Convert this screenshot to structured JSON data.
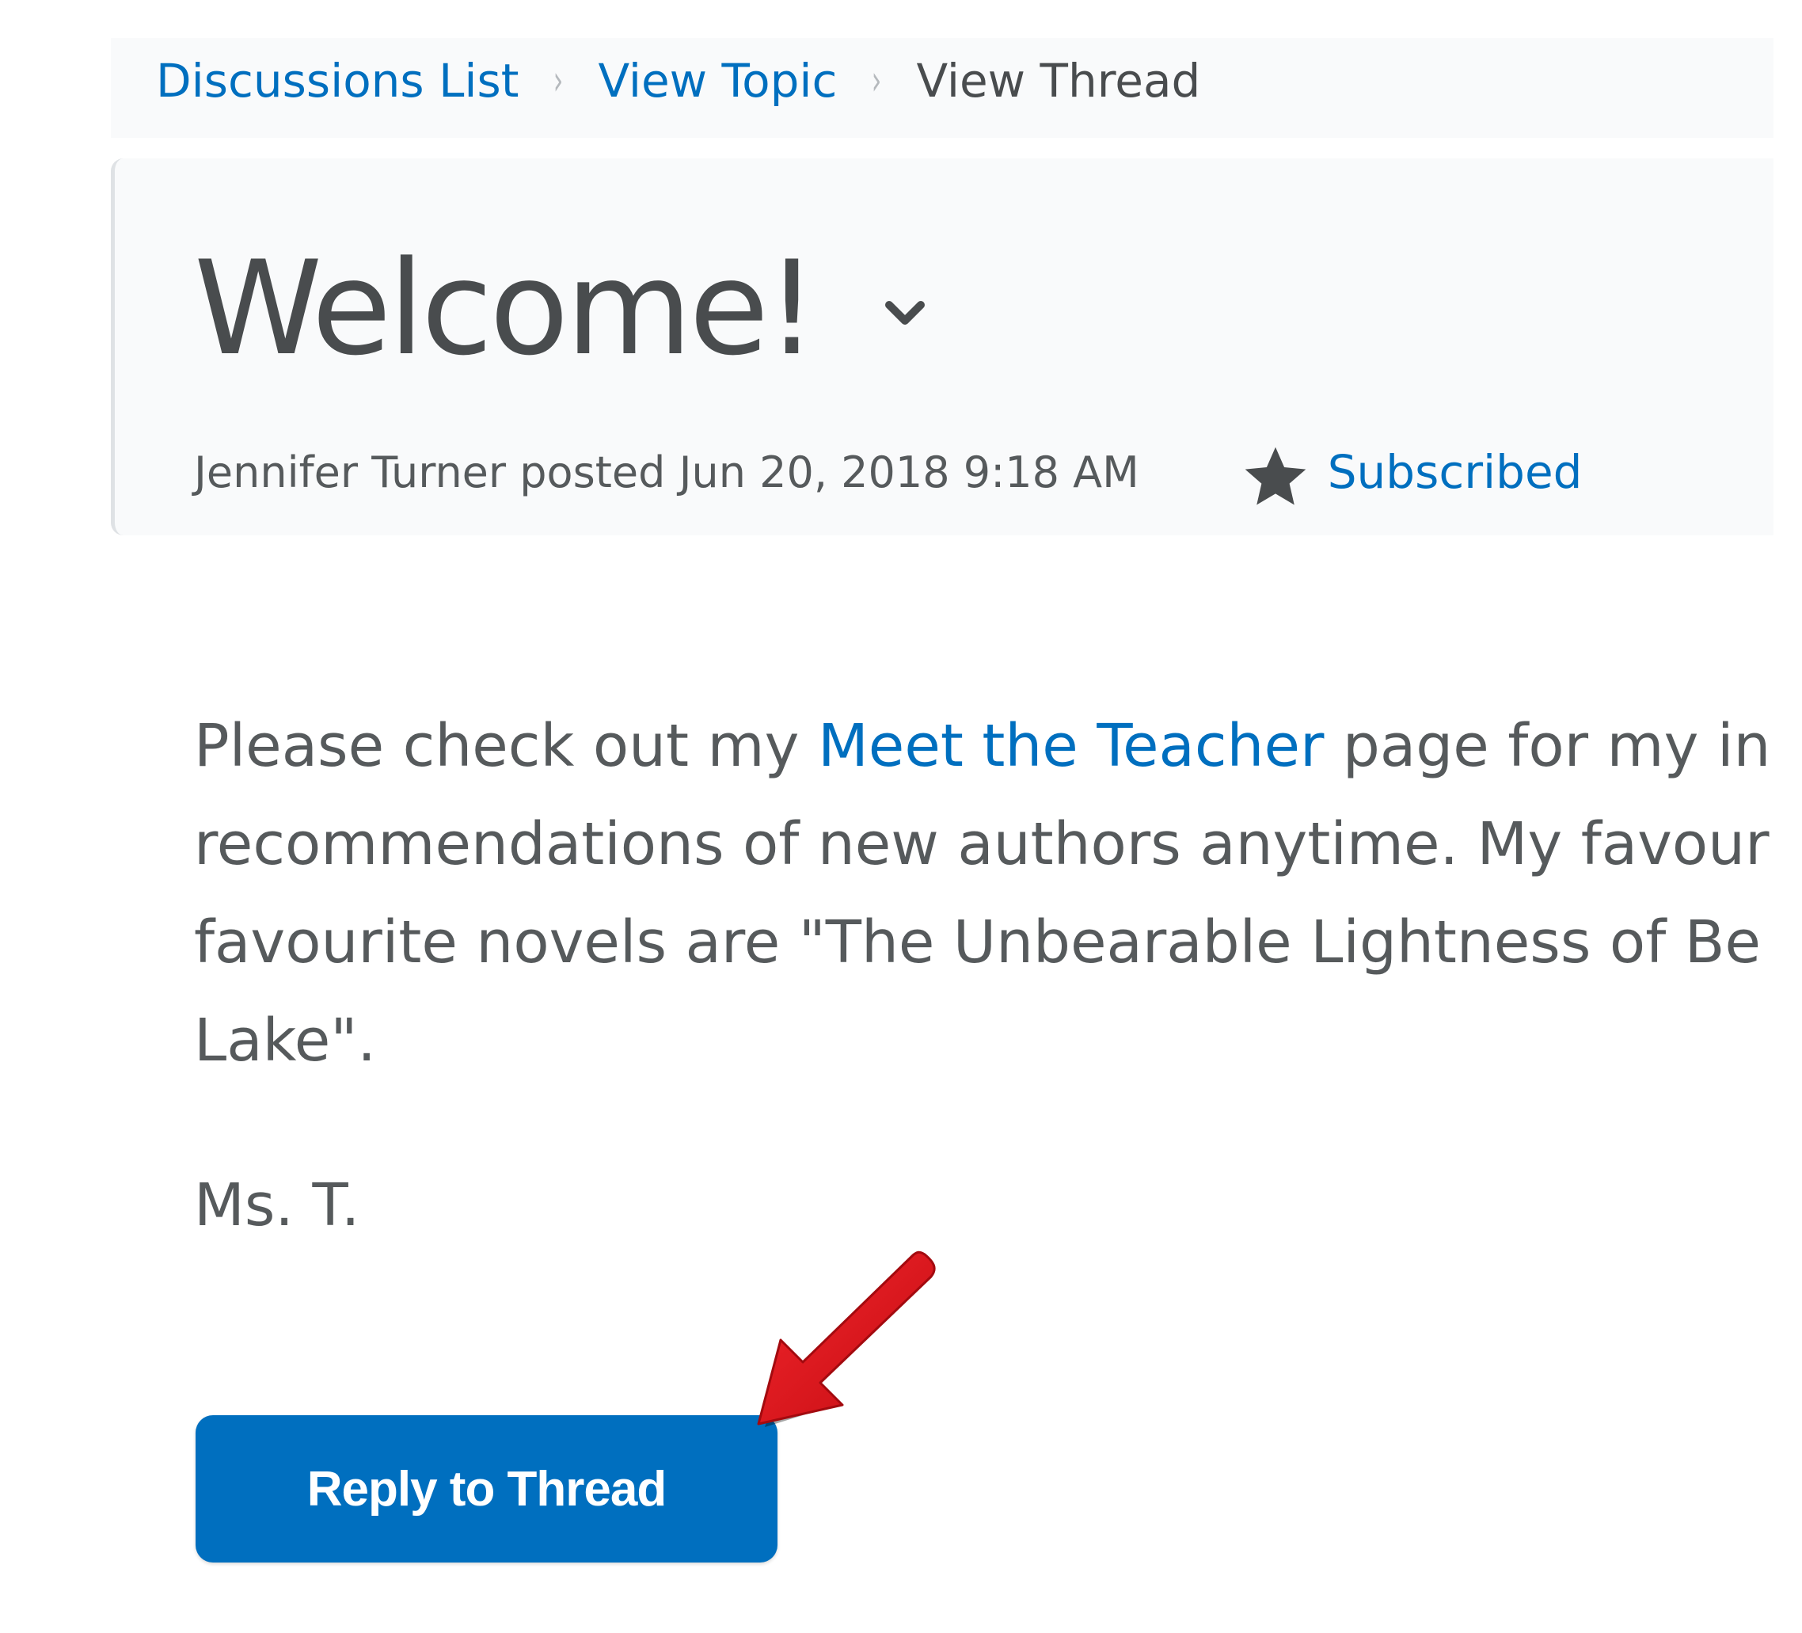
{
  "breadcrumb": {
    "items": [
      "Discussions List",
      "View Topic",
      "View Thread"
    ],
    "separator": "›"
  },
  "thread": {
    "title": "Welcome!",
    "meta": "Jennifer Turner posted Jun 20, 2018 9:18 AM",
    "subscribe_label": "Subscribed"
  },
  "message": {
    "line1_prefix": "Please check out my ",
    "link_text": "Meet the Teacher",
    "line1_suffix": " page for my in",
    "line2": "recommendations of new authors anytime. My favour",
    "line3": "favourite novels are \"The Unbearable Lightness of Be",
    "line4": "Lake\".",
    "signature": "Ms. T."
  },
  "actions": {
    "reply_label": "Reply to Thread"
  },
  "icons": {
    "title_menu": "chevron-down-icon",
    "subscribe": "star-icon",
    "annotation": "red-arrow-annotation"
  },
  "colors": {
    "link": "#006fbf",
    "primary_button": "#006fbf",
    "text": "#494c4e",
    "annotation_arrow": "#e0141c"
  }
}
